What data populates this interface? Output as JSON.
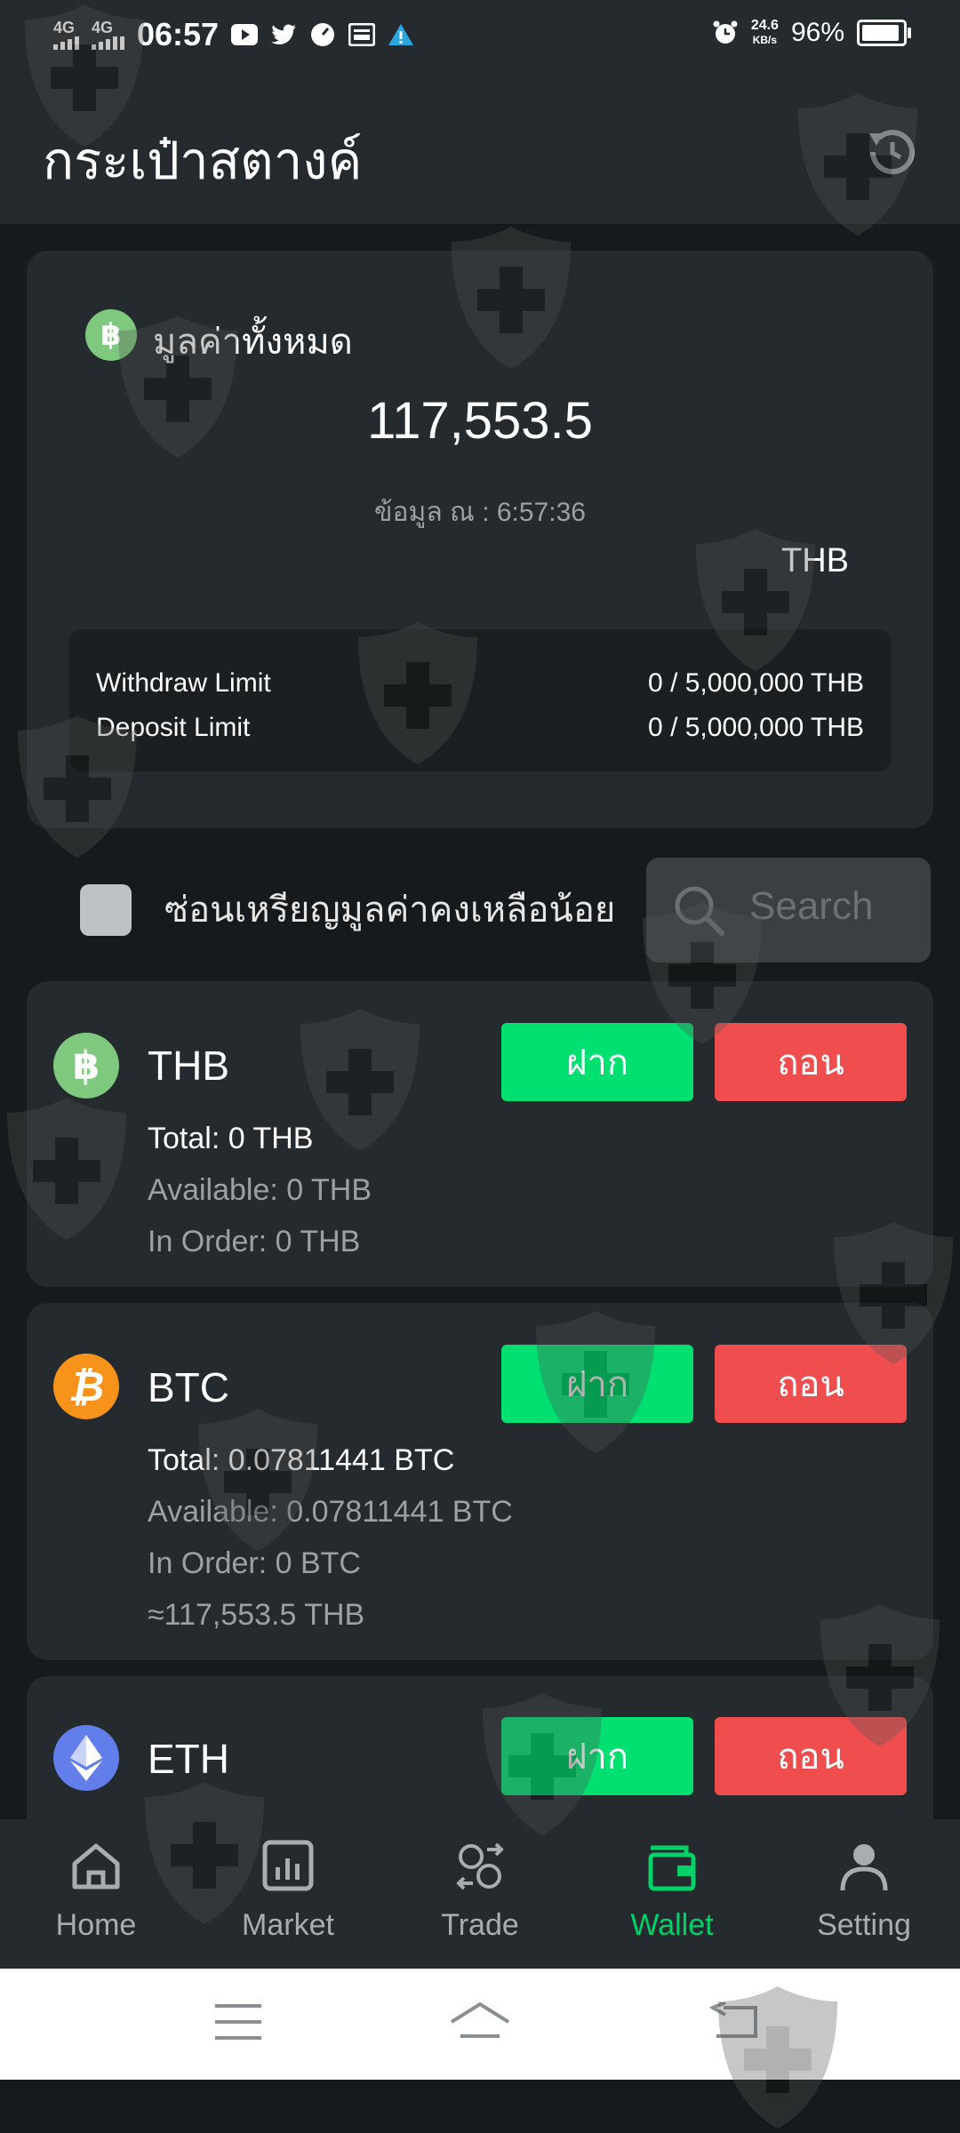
{
  "status_bar": {
    "network1": "4G",
    "network2": "4G",
    "time": "06:57",
    "net_speed_value": "24.6",
    "net_speed_unit": "KB/s",
    "battery": "96%",
    "icons": [
      "youtube-icon",
      "twitter-icon",
      "speedometer-icon",
      "mail-icon",
      "warning-icon",
      "alarm-icon"
    ]
  },
  "header": {
    "title": "กระเป๋าสตางค์",
    "history_icon": "history-icon"
  },
  "summary": {
    "label": "มูลค่าทั้งหมด",
    "total": "117,553.5",
    "timestamp": "ข้อมูล ณ : 6:57:36",
    "currency": "THB",
    "limits": [
      {
        "label": "Withdraw Limit",
        "value": "0 / 5,000,000 THB"
      },
      {
        "label": "Deposit Limit",
        "value": "0 / 5,000,000 THB"
      }
    ]
  },
  "filter": {
    "hide_small_label": "ซ่อนเหรียญมูลค่าคงเหลือน้อย",
    "search_placeholder": "Search"
  },
  "assets": [
    {
      "symbol": "THB",
      "deposit_label": "ฝาก",
      "withdraw_label": "ถอน",
      "total": "Total: 0 THB",
      "available": "Available: 0 THB",
      "in_order": "In Order: 0 THB",
      "color": "#7fc97f"
    },
    {
      "symbol": "BTC",
      "deposit_label": "ฝาก",
      "withdraw_label": "ถอน",
      "total": "Total: 0.07811441 BTC",
      "available": "Available: 0.07811441 BTC",
      "in_order": "In Order: 0 BTC",
      "approx": "≈117,553.5 THB",
      "color": "#f7931a"
    },
    {
      "symbol": "ETH",
      "deposit_label": "ฝาก",
      "withdraw_label": "ถอน",
      "color": "#627eea"
    }
  ],
  "bottom_nav": [
    {
      "label": "Home",
      "icon": "home-icon"
    },
    {
      "label": "Market",
      "icon": "market-chart-icon"
    },
    {
      "label": "Trade",
      "icon": "trade-exchange-icon"
    },
    {
      "label": "Wallet",
      "icon": "wallet-icon",
      "active": true
    },
    {
      "label": "Setting",
      "icon": "user-icon"
    }
  ],
  "colors": {
    "background": "#161a1c",
    "card": "#252a2e",
    "deposit_green": "#00e071",
    "withdraw_red": "#f04e4e",
    "active_nav": "#00d26a"
  }
}
